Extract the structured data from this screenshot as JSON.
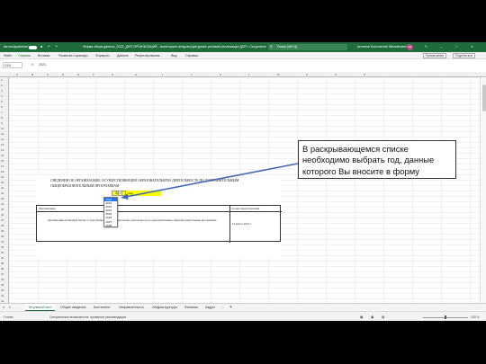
{
  "titlebar": {
    "autosave": "Автосохранение",
    "filename": "Форма сбора данных_2022_ДЛЯ ОРГАНИЗАЦИЙ - мониторинг инфраструктурных условий реализации ДОП • Сохранено",
    "search": "Поиск (Alt+Q)",
    "user": "Антонов Константин Михайлович",
    "avatar": "КА"
  },
  "menu": {
    "items": [
      "Файл",
      "Главная",
      "Вставка",
      "Разметка страницы",
      "Формулы",
      "Данные",
      "Рецензирование",
      "Вид",
      "Справка"
    ],
    "notes": "Примечания",
    "share": "Поделиться"
  },
  "formula": {
    "cell": "G16",
    "fx": "fx",
    "value": "2021"
  },
  "columns": [
    "A",
    "B",
    "C",
    "D",
    "E",
    "F",
    "G",
    "H",
    "I",
    "J",
    "K",
    "L",
    "M",
    "N",
    "O",
    "P"
  ],
  "rows": [
    "1",
    "2",
    "3",
    "4",
    "5",
    "6",
    "7",
    "8",
    "9",
    "10",
    "11",
    "12",
    "13",
    "14",
    "15",
    "16",
    "17",
    "18",
    "19",
    "20",
    "21",
    "22",
    "23",
    "24",
    "25",
    "26",
    "27",
    "28",
    "29",
    "30",
    "31",
    "32",
    "33",
    "34",
    "35",
    "36",
    "37",
    "38",
    "39",
    "40",
    "41",
    "42",
    "43"
  ],
  "doc": {
    "title": "СВЕДЕНИЯ ОБ ОРГАНИЗАЦИИ, ОСУЩЕСТВЛЯЮЩЕЙ ОБРАЗОВАТЕЛЬНУЮ ДЕЯТЕЛЬНОСТЬ ПО ДОПОЛНИТЕЛЬНЫМ ОБЩЕОБРАЗОВАТЕЛЬНЫМ ПРОГРАММАМ",
    "year": "2021",
    "year_caption": "году",
    "col_org": "Организация",
    "col_date": "Сроки представления",
    "row_text": "Организации различных типов, осуществляющие образовательную деятельность по дополнительным общеобразовательным программам",
    "row_date": "10 марта 2022 г."
  },
  "dropdown": {
    "options": [
      "2021",
      "2022",
      "2023",
      "2024",
      "2025",
      "2026",
      "2027",
      "2028"
    ],
    "selected": "2021",
    "arrow": "▾"
  },
  "callout": "В раскрывающемся списке необходимо выбрать год, данные которого Вы вносите в форму",
  "sheets": [
    "Титульный лист",
    "Общие сведения",
    "Контингент",
    "Направленность",
    "Инфраструктура",
    "Финансы",
    "Кадры"
  ],
  "sheet_nav": {
    "prev": "◂",
    "next": "▸",
    "more": "...",
    "add": "+"
  },
  "status": {
    "left": "Готово",
    "accessibility": "Специальные возможности: проверьте рекомендации",
    "zoom": "100 %"
  }
}
